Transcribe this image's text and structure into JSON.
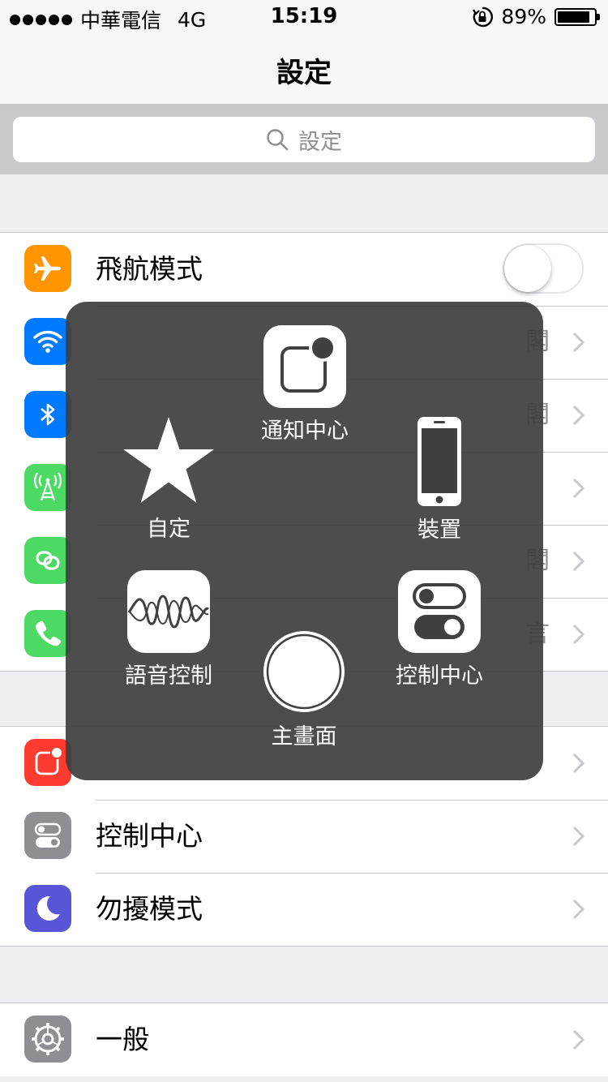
{
  "status_bar": {
    "carrier": "中華電信",
    "network": "4G",
    "time": "15:19",
    "battery": "89%",
    "battery_level": 0.89
  },
  "nav": {
    "title": "設定"
  },
  "search": {
    "placeholder": "設定"
  },
  "colors": {
    "airplane": "#ff9500",
    "wifi": "#007aff",
    "bluetooth": "#007aff",
    "cellular": "#4cd964",
    "hotspot": "#4cd964",
    "phone": "#4cd964",
    "notifications": "#ff3b30",
    "control_center": "#8e8e93",
    "dnd": "#5856d6",
    "general": "#8e8e93"
  },
  "group1": {
    "rows": [
      {
        "icon": "airplane-icon",
        "label": "飛航模式",
        "toggle": false
      },
      {
        "icon": "wifi-icon",
        "value": "閣"
      },
      {
        "icon": "bluetooth-icon",
        "value": "閣"
      },
      {
        "icon": "cellular-icon"
      },
      {
        "icon": "hotspot-icon",
        "value": "閣"
      },
      {
        "icon": "phone-icon",
        "value": "言"
      }
    ]
  },
  "group2": {
    "rows": [
      {
        "icon": "notifications-icon"
      },
      {
        "icon": "control-center-icon",
        "label": "控制中心"
      },
      {
        "icon": "moon-icon",
        "label": "勿擾模式"
      }
    ]
  },
  "group3": {
    "rows": [
      {
        "icon": "gear-icon",
        "label": "一般"
      }
    ]
  },
  "assistive_touch": {
    "notification_center": "通知中心",
    "custom": "自定",
    "device": "裝置",
    "siri": "語音控制",
    "control_center": "控制中心",
    "home": "主畫面"
  }
}
